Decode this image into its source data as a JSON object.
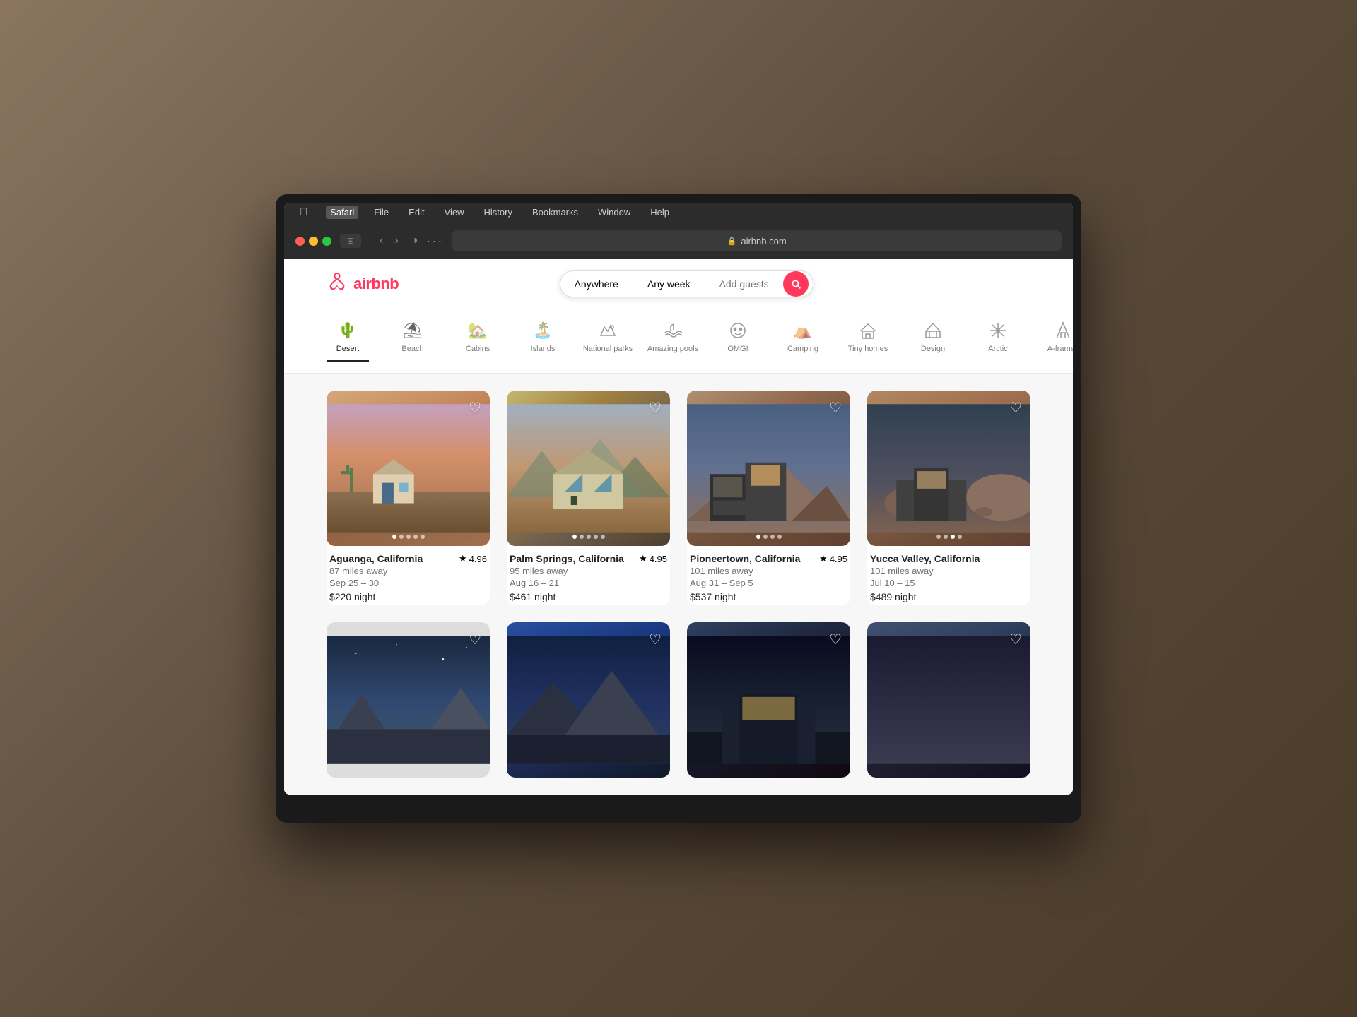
{
  "browser": {
    "menu_items": [
      "",
      "Safari",
      "File",
      "Edit",
      "View",
      "History",
      "Bookmarks",
      "Window",
      "Help"
    ],
    "url": "airbnb.com",
    "back_arrow": "‹",
    "forward_arrow": "›"
  },
  "airbnb": {
    "logo_text": "airbnb",
    "search": {
      "anywhere_label": "Anywhere",
      "any_week_label": "Any week",
      "add_guests_label": "Add guests"
    },
    "categories": [
      {
        "id": "desert",
        "label": "Desert",
        "icon": "🌵",
        "active": true
      },
      {
        "id": "beach",
        "label": "Beach",
        "icon": "⛱"
      },
      {
        "id": "cabins",
        "label": "Cabins",
        "icon": "🏡"
      },
      {
        "id": "islands",
        "label": "Islands",
        "icon": "🏝️"
      },
      {
        "id": "national-parks",
        "label": "National parks",
        "icon": "🏕️"
      },
      {
        "id": "amazing-pools",
        "label": "Amazing pools",
        "icon": "🏊"
      },
      {
        "id": "omg",
        "label": "OMG!",
        "icon": "😮"
      },
      {
        "id": "camping",
        "label": "Camping",
        "icon": "⛺"
      },
      {
        "id": "tiny-homes",
        "label": "Tiny homes",
        "icon": "🏠"
      },
      {
        "id": "design",
        "label": "Design",
        "icon": "🏛️"
      },
      {
        "id": "arctic",
        "label": "Arctic",
        "icon": "❄️"
      },
      {
        "id": "a-frames",
        "label": "A-frames",
        "icon": "🔺"
      }
    ],
    "listings": [
      {
        "title": "Aguanga, California",
        "miles": "87 miles away",
        "dates": "Sep 25 – 30",
        "price": "$220",
        "rating": "4.96",
        "img_class": "img-desert-1"
      },
      {
        "title": "Palm Springs, California",
        "miles": "95 miles away",
        "dates": "Aug 16 – 21",
        "price": "$461",
        "rating": "4.95",
        "img_class": "img-desert-2"
      },
      {
        "title": "Pioneertown, California",
        "miles": "101 miles away",
        "dates": "Aug 31 – Sep 5",
        "price": "$537",
        "rating": "4.95",
        "img_class": "img-desert-3"
      },
      {
        "title": "Yucca Valley, California",
        "miles": "101 miles away",
        "dates": "Jul 10 – 15",
        "price": "$489",
        "rating": "",
        "img_class": "img-desert-4",
        "partial": true
      }
    ],
    "second_row": [
      {
        "img_class": "img-sky-1"
      },
      {
        "img_class": "img-sky-2"
      },
      {
        "img_class": "img-sky-3"
      },
      {
        "img_class": "img-sky-1"
      }
    ],
    "night_label": "night",
    "star_symbol": "★"
  }
}
